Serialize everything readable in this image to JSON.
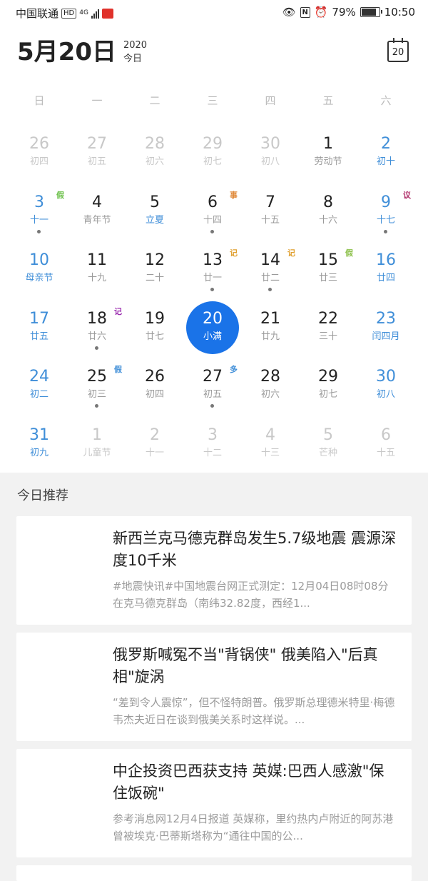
{
  "status": {
    "carrier": "中国联通",
    "hd": "HD",
    "net": "4G",
    "battery": "79%",
    "time": "10:50"
  },
  "header": {
    "date": "5月20日",
    "year": "2020",
    "today": "今日",
    "calendar_icon_day": "20"
  },
  "weekdays": [
    "日",
    "一",
    "二",
    "三",
    "四",
    "五",
    "六"
  ],
  "weeks": [
    [
      {
        "n": "26",
        "l": "初四",
        "s": "muted"
      },
      {
        "n": "27",
        "l": "初五",
        "s": "muted"
      },
      {
        "n": "28",
        "l": "初六",
        "s": "muted"
      },
      {
        "n": "29",
        "l": "初七",
        "s": "muted"
      },
      {
        "n": "30",
        "l": "初八",
        "s": "muted"
      },
      {
        "n": "1",
        "l": "劳动节"
      },
      {
        "n": "2",
        "l": "初十",
        "s": "blue"
      }
    ],
    [
      {
        "n": "3",
        "l": "十一",
        "s": "blue",
        "tag": "假",
        "tc": "#6cc04a",
        "dot": true
      },
      {
        "n": "4",
        "l": "青年节"
      },
      {
        "n": "5",
        "l": "立夏",
        "lc": "#3f8ed8"
      },
      {
        "n": "6",
        "l": "十四",
        "tag": "事",
        "tc": "#e08a3a",
        "dot": true
      },
      {
        "n": "7",
        "l": "十五"
      },
      {
        "n": "8",
        "l": "十六"
      },
      {
        "n": "9",
        "l": "十七",
        "s": "blue",
        "tag": "议",
        "tc": "#b0306a",
        "dot": true
      }
    ],
    [
      {
        "n": "10",
        "l": "母亲节",
        "s": "blue"
      },
      {
        "n": "11",
        "l": "十九"
      },
      {
        "n": "12",
        "l": "二十"
      },
      {
        "n": "13",
        "l": "廿一",
        "tag": "记",
        "tc": "#e0a030",
        "dot": true
      },
      {
        "n": "14",
        "l": "廿二",
        "tag": "记",
        "tc": "#e0a030",
        "dot": true
      },
      {
        "n": "15",
        "l": "廿三",
        "tag": "假",
        "tc": "#8cc04a"
      },
      {
        "n": "16",
        "l": "廿四",
        "s": "blue"
      }
    ],
    [
      {
        "n": "17",
        "l": "廿五",
        "s": "blue"
      },
      {
        "n": "18",
        "l": "廿六",
        "tag": "记",
        "tc": "#9c2fb0",
        "dot": true
      },
      {
        "n": "19",
        "l": "廿七"
      },
      {
        "n": "20",
        "l": "小满",
        "s": "sel"
      },
      {
        "n": "21",
        "l": "廿九"
      },
      {
        "n": "22",
        "l": "三十"
      },
      {
        "n": "23",
        "l": "闰四月",
        "s": "blue"
      }
    ],
    [
      {
        "n": "24",
        "l": "初二",
        "s": "blue"
      },
      {
        "n": "25",
        "l": "初三",
        "tag": "假",
        "tc": "#3f8ed8",
        "dot": true
      },
      {
        "n": "26",
        "l": "初四"
      },
      {
        "n": "27",
        "l": "初五",
        "tag": "多",
        "tc": "#3f8ed8",
        "dot": true
      },
      {
        "n": "28",
        "l": "初六"
      },
      {
        "n": "29",
        "l": "初七"
      },
      {
        "n": "30",
        "l": "初八",
        "s": "blue"
      }
    ],
    [
      {
        "n": "31",
        "l": "初九",
        "s": "blue"
      },
      {
        "n": "1",
        "l": "儿童节",
        "s": "muted"
      },
      {
        "n": "2",
        "l": "十一",
        "s": "muted"
      },
      {
        "n": "3",
        "l": "十二",
        "s": "muted"
      },
      {
        "n": "4",
        "l": "十三",
        "s": "muted"
      },
      {
        "n": "5",
        "l": "芒种",
        "s": "muted"
      },
      {
        "n": "6",
        "l": "十五",
        "s": "muted"
      }
    ]
  ],
  "recommend": {
    "heading": "今日推荐",
    "cards": [
      {
        "title": "新西兰克马德克群岛发生5.7级地震 震源深度10千米",
        "summary": "#地震快讯#中国地震台网正式测定：12月04日08时08分在克马德克群岛（南纬32.82度，西经1..."
      },
      {
        "title": "俄罗斯喊冤不当\"背锅侠\" 俄美陷入\"后真相\"旋涡",
        "summary": "“差到令人震惊”，但不怪特朗普。俄罗斯总理德米特里·梅德韦杰夫近日在谈到俄美关系时这样说。..."
      },
      {
        "title": "中企投资巴西获支持 英媒:巴西人感激\"保住饭碗\"",
        "summary": "参考消息网12月4日报道 英媒称，里约热内卢附近的阿苏港曾被埃克·巴蒂斯塔称为“通往中国的公..."
      }
    ]
  }
}
